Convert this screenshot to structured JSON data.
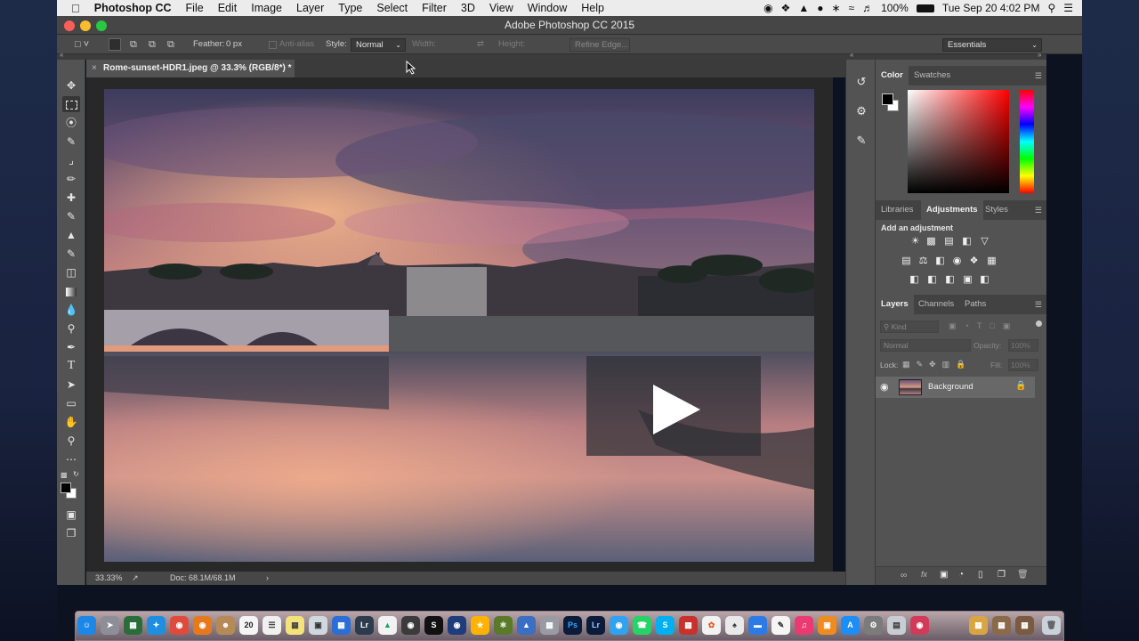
{
  "menubar": {
    "apple": "",
    "app": "Photoshop CC",
    "items": [
      "File",
      "Edit",
      "Image",
      "Layer",
      "Type",
      "Select",
      "Filter",
      "3D",
      "View",
      "Window",
      "Help"
    ],
    "battery": "100%",
    "datetime": "Tue Sep 20  4:02 PM"
  },
  "window": {
    "title": "Adobe Photoshop CC 2015"
  },
  "options": {
    "feather_label": "Feather:",
    "feather_value": "0 px",
    "antialias": "Anti-alias",
    "style_label": "Style:",
    "style_value": "Normal",
    "width_label": "Width:",
    "height_label": "Height:",
    "refine_edge": "Refine Edge...",
    "workspace": "Essentials"
  },
  "document": {
    "tab_title": "Rome-sunset-HDR1.jpeg @ 33.3% (RGB/8*) *",
    "zoom": "33.33%",
    "doc_size": "Doc: 68.1M/68.1M"
  },
  "color_panel": {
    "tabs": [
      "Color",
      "Swatches"
    ],
    "active": "Color"
  },
  "adjustments_panel": {
    "tabs": [
      "Libraries",
      "Adjustments",
      "Styles"
    ],
    "active": "Adjustments",
    "heading": "Add an adjustment"
  },
  "layers_panel": {
    "tabs": [
      "Layers",
      "Channels",
      "Paths"
    ],
    "active": "Layers",
    "kind_placeholder": "Kind",
    "blend_mode": "Normal",
    "opacity_label": "Opacity:",
    "opacity_value": "100%",
    "lock_label": "Lock:",
    "fill_label": "Fill:",
    "fill_value": "100%",
    "layers": [
      {
        "name": "Background",
        "visible": true,
        "locked": true
      }
    ]
  },
  "dock": {
    "calendar_day": "20",
    "apps": [
      "Finder",
      "Launchpad",
      "Mission Control",
      "Safari",
      "Chrome",
      "Firefox",
      "Contacts",
      "Calendar",
      "Notes",
      "Stickies",
      "Preview",
      "Keynote",
      "Lightroom",
      "Google Drive",
      "Image Capture",
      "Sonos",
      "Photos",
      "Xcode",
      "Atom",
      "Keynote 2",
      "Photoshop",
      "Lightroom 2",
      "Messages",
      "WhatsApp",
      "Skype",
      "Photo Booth",
      "Photos 2",
      "Font Book",
      "Pages",
      "iTunes",
      "iBooks",
      "App Store",
      "System Preferences",
      "Disk Utility",
      "Flashcard",
      "Downloads",
      "Documents",
      "Stacks",
      "Trash"
    ]
  },
  "colors": {
    "accent": "#1f7ad8",
    "panel_bg": "#535353",
    "canvas_bg": "#282828",
    "menubar": "#ececec"
  }
}
